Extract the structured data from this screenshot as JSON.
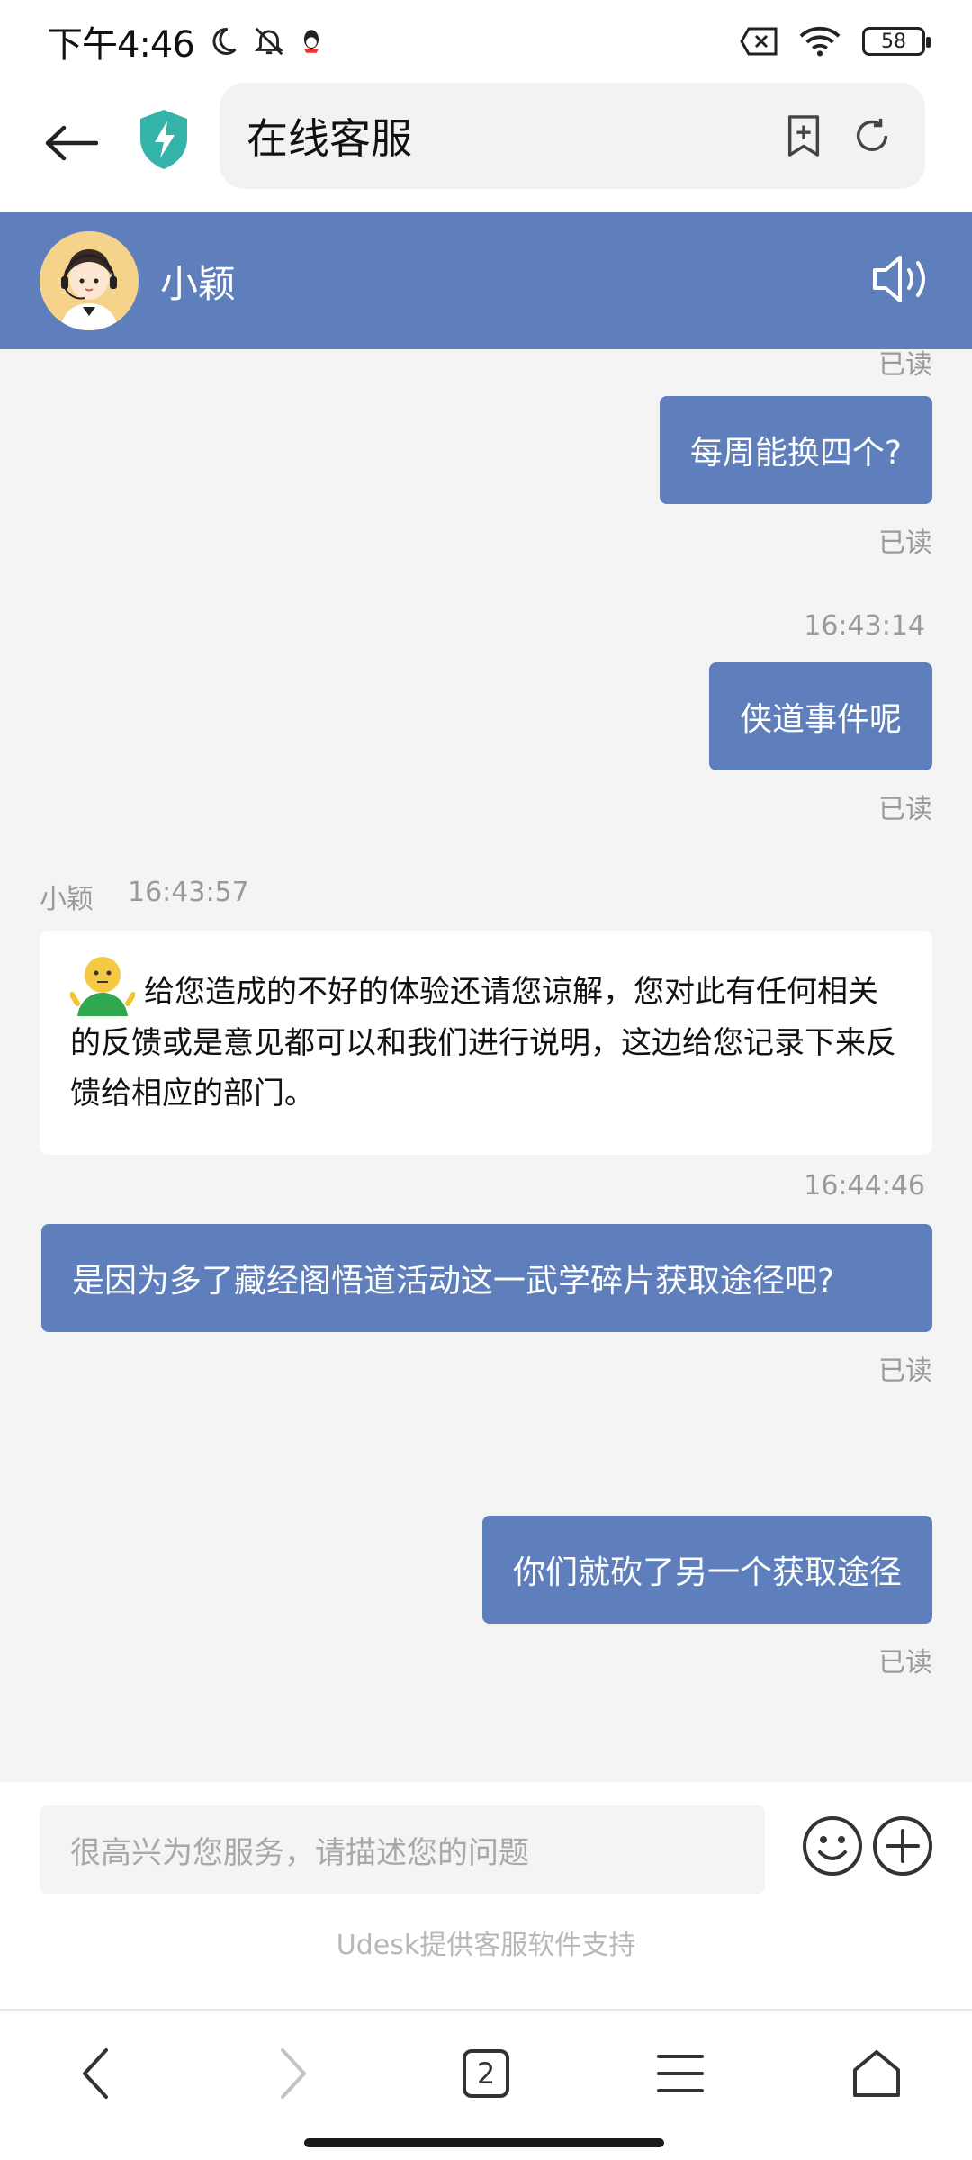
{
  "status_bar": {
    "time": "下午4:46",
    "battery": "58"
  },
  "browser": {
    "title": "在线客服",
    "tab_count": "2"
  },
  "chat_header": {
    "agent_name": "小颖"
  },
  "messages": [
    {
      "type": "read",
      "text": "已读"
    },
    {
      "type": "outgoing",
      "text": "每周能换四个?"
    },
    {
      "type": "read",
      "text": "已读"
    },
    {
      "type": "timestamp",
      "text": "16:43:14"
    },
    {
      "type": "outgoing",
      "text": "侠道事件呢"
    },
    {
      "type": "read",
      "text": "已读"
    },
    {
      "type": "agent_meta",
      "name": "小颖",
      "time": "16:43:57"
    },
    {
      "type": "incoming",
      "text": "给您造成的不好的体验还请您谅解，您对此有任何相关的反馈或是意见都可以和我们进行说明，这边给您记录下来反馈给相应的部门。"
    },
    {
      "type": "timestamp",
      "text": "16:44:46"
    },
    {
      "type": "outgoing",
      "text": "是因为多了藏经阁悟道活动这一武学碎片获取途径吧?"
    },
    {
      "type": "read",
      "text": "已读"
    },
    {
      "type": "outgoing",
      "text": "你们就砍了另一个获取途径"
    },
    {
      "type": "read",
      "text": "已读"
    }
  ],
  "input": {
    "placeholder": "很高兴为您服务，请描述您的问题",
    "powered_by": "Udesk提供客服软件支持"
  },
  "colors": {
    "accent": "#5e7fbc",
    "background": "#f4f4f4"
  }
}
